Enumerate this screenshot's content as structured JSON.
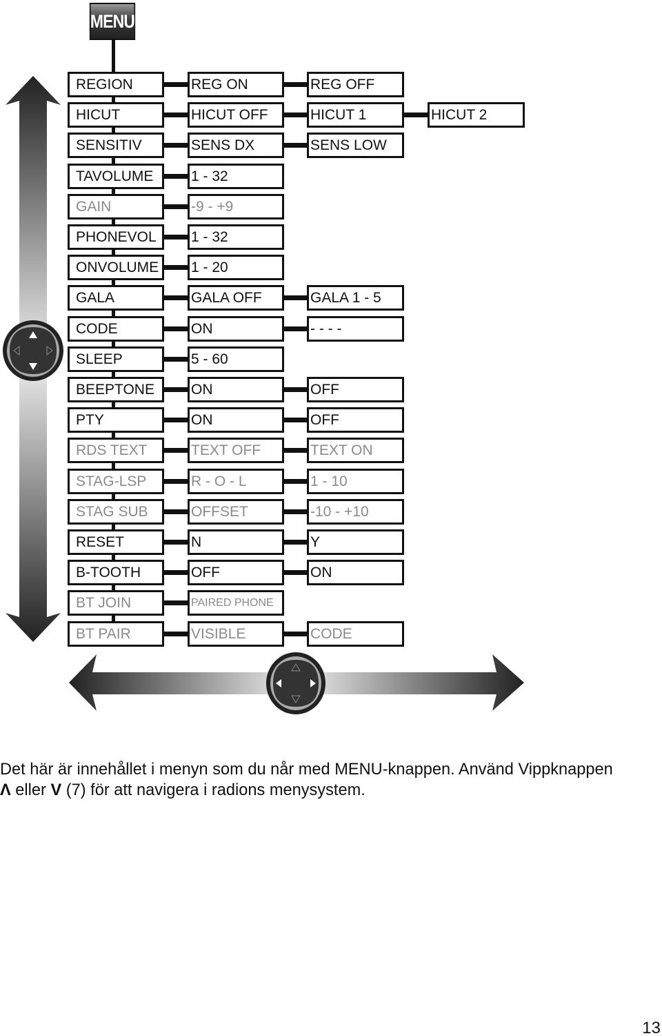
{
  "menu_button": {
    "label": "MENU"
  },
  "menu_rows": [
    {
      "items": [
        "REGION",
        "REG ON",
        "REG OFF"
      ],
      "muted": false
    },
    {
      "items": [
        "HICUT",
        "HICUT OFF",
        "HICUT 1",
        "HICUT 2"
      ],
      "muted": false
    },
    {
      "items": [
        "SENSITIV",
        "SENS DX",
        "SENS LOW"
      ],
      "muted": false
    },
    {
      "items": [
        "TAVOLUME",
        "1 - 32"
      ],
      "muted": false
    },
    {
      "items": [
        "GAIN",
        "-9 - +9"
      ],
      "muted": true
    },
    {
      "items": [
        "PHONEVOL",
        "1 - 32"
      ],
      "muted": false
    },
    {
      "items": [
        "ONVOLUME",
        "1 - 20"
      ],
      "muted": false
    },
    {
      "items": [
        "GALA",
        "GALA OFF",
        "GALA 1 - 5"
      ],
      "muted": false
    },
    {
      "items": [
        "CODE",
        "ON",
        "- - - -"
      ],
      "muted": false
    },
    {
      "items": [
        "SLEEP",
        "5 - 60"
      ],
      "muted": false
    },
    {
      "items": [
        "BEEPTONE",
        "ON",
        "OFF"
      ],
      "muted": false
    },
    {
      "items": [
        "PTY",
        "ON",
        "OFF"
      ],
      "muted": false
    },
    {
      "items": [
        "RDS TEXT",
        "TEXT OFF",
        "TEXT ON"
      ],
      "muted": true
    },
    {
      "items": [
        "STAG-LSP",
        "R - O - L",
        "1 - 10"
      ],
      "muted": true
    },
    {
      "items": [
        "STAG SUB",
        "OFFSET",
        "-10 - +10"
      ],
      "muted": true
    },
    {
      "items": [
        "RESET",
        "N",
        "Y"
      ],
      "muted": false
    },
    {
      "items": [
        "B-TOOTH",
        "OFF",
        "ON"
      ],
      "muted": false
    },
    {
      "items": [
        "BT JOIN",
        "PAIRED PHONE"
      ],
      "muted": true
    },
    {
      "items": [
        "BT PAIR",
        "VISIBLE",
        "CODE"
      ],
      "muted": true
    }
  ],
  "icons": {
    "vertical_nav": "up-down-arrow",
    "horizontal_nav": "left-right-arrow",
    "joystick": "joystick-button"
  },
  "caption": {
    "line1": "Det här är innehållet i menyn som du når med MENU-knappen. Använd Vippknappen",
    "up_symbol": "Λ",
    "line2_a": " eller ",
    "down_symbol": "V",
    "line2_b": " (7) för att navigera i radions menysystem."
  },
  "page_number": "13"
}
